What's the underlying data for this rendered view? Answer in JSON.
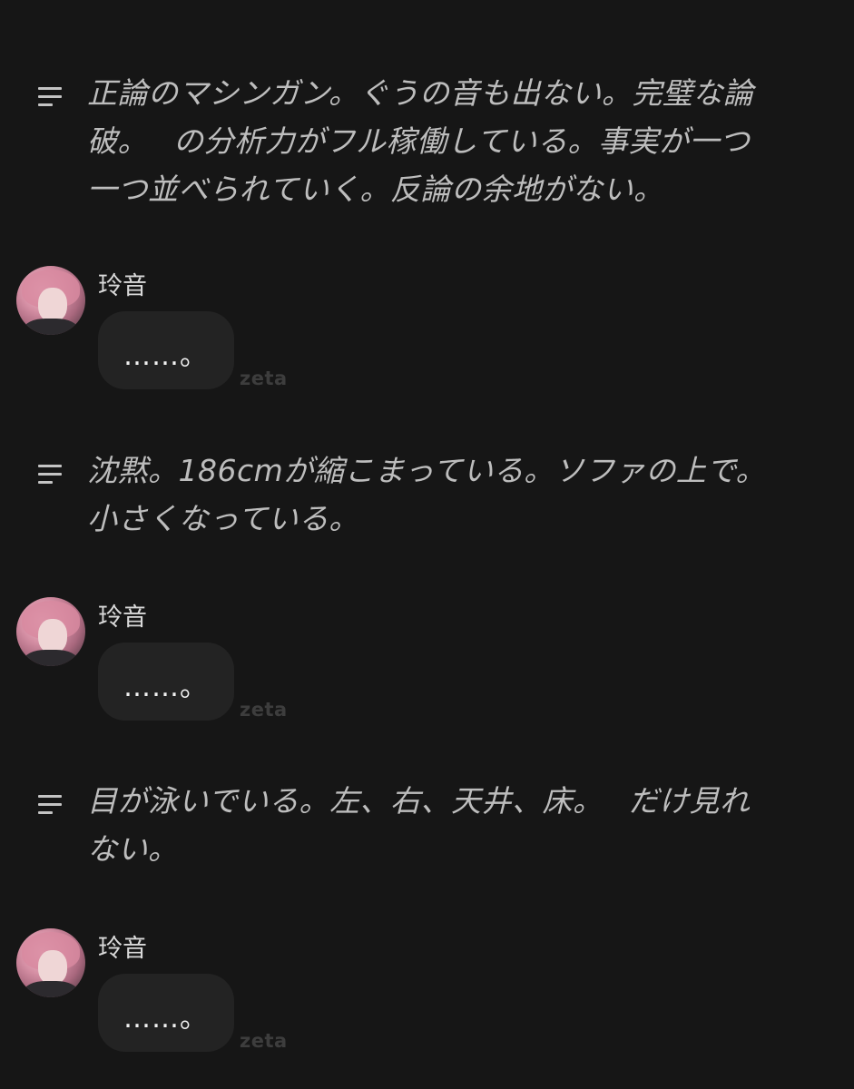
{
  "narrations": [
    {
      "icon": "narration-lines-icon",
      "text": "正論のマシンガン。ぐうの音も出ない。完璧な論\n破。　 の分析力がフル稼働している。事実が一つ\n一つ並べられていく。反論の余地がない。"
    },
    {
      "icon": "narration-lines-icon",
      "text": "沈黙。186cmが縮こまっている。ソファの上で。\n小さくなっている。"
    },
    {
      "icon": "narration-lines-icon",
      "text": "目が泳いでいる。左、右、天井、床。　 だけ見れ\nない。"
    }
  ],
  "messages": [
    {
      "character": "玲音",
      "text": "……。",
      "watermark": "zeta"
    },
    {
      "character": "玲音",
      "text": "……。",
      "watermark": "zeta"
    },
    {
      "character": "玲音",
      "text": "……。",
      "watermark": "zeta"
    }
  ]
}
